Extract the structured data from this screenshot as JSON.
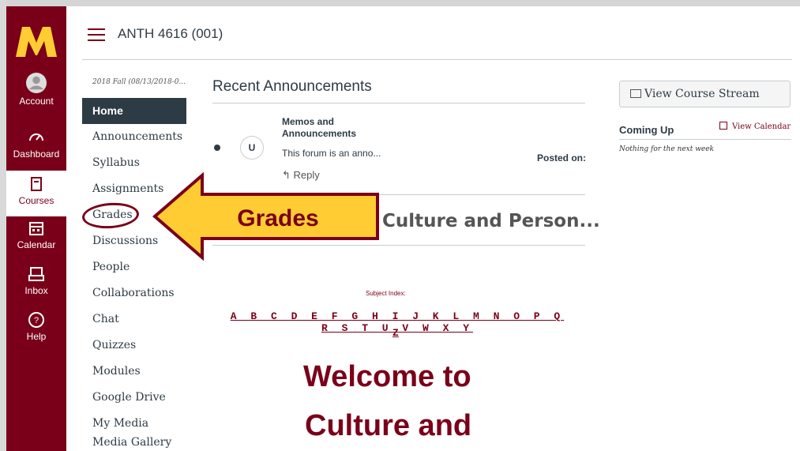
{
  "global_nav": {
    "items": [
      {
        "label": "Account",
        "icon": "account-icon"
      },
      {
        "label": "Dashboard",
        "icon": "dashboard-icon"
      },
      {
        "label": "Courses",
        "icon": "courses-icon"
      },
      {
        "label": "Calendar",
        "icon": "calendar-icon"
      },
      {
        "label": "Inbox",
        "icon": "inbox-icon"
      },
      {
        "label": "Help",
        "icon": "help-icon"
      }
    ]
  },
  "header": {
    "course_title": "ANTH 4616 (001)"
  },
  "course_nav": {
    "term": "2018 Fall (08/13/2018-0...",
    "items": [
      {
        "label": "Home"
      },
      {
        "label": "Announcements"
      },
      {
        "label": "Syllabus"
      },
      {
        "label": "Assignments"
      },
      {
        "label": "Grades"
      },
      {
        "label": "Discussions"
      },
      {
        "label": "People"
      },
      {
        "label": "Collaborations"
      },
      {
        "label": "Chat"
      },
      {
        "label": "Quizzes"
      },
      {
        "label": "Modules"
      },
      {
        "label": "Google Drive"
      },
      {
        "label": "My Media"
      },
      {
        "label": "Media Gallery"
      }
    ]
  },
  "announcements": {
    "heading": "Recent Announcements",
    "subject": "Memos and Announcements",
    "avatar_initial": "U",
    "preview": "This forum is an anno...",
    "posted": "Posted on:",
    "reply": "Reply"
  },
  "callout": {
    "label": "Grades"
  },
  "page": {
    "title": "Culture and Person...",
    "subject_index_label": "Subject Index:",
    "letters": "A B C D E F G H I J K L M N O P Q R S T U V W X Y",
    "last_letter": "Z",
    "welcome_line1": "Welcome to",
    "welcome_line2": "Culture and"
  },
  "sidebar": {
    "stream_button": "View Course Stream",
    "coming_up": "Coming Up",
    "view_calendar": "View Calendar",
    "nothing": "Nothing for the next week"
  },
  "colors": {
    "brand": "#7a0019",
    "gold": "#ffcc33",
    "nav_active_bg": "#2d3b45"
  }
}
